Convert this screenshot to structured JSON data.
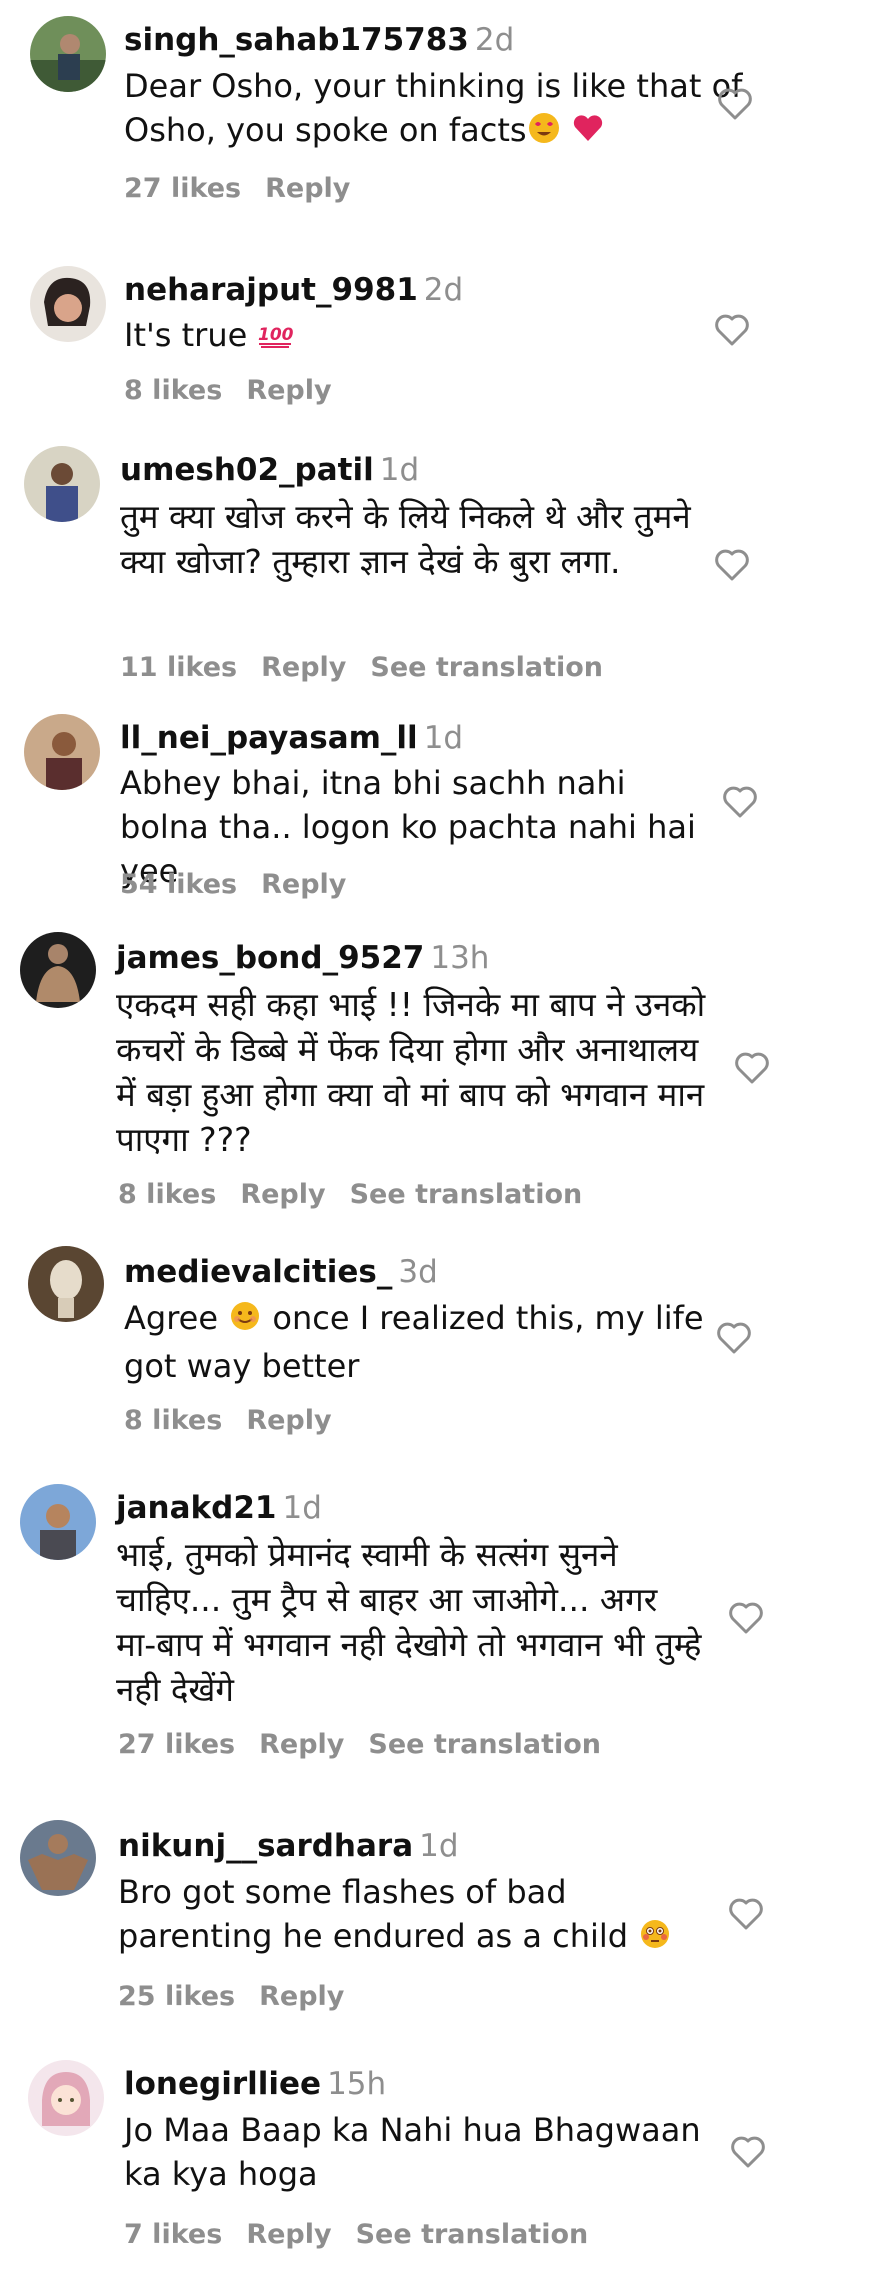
{
  "comments": [
    {
      "username": "singh_sahab175783",
      "time": "2d",
      "text": "Dear Osho, your thinking is like that of Osho, you spoke on facts",
      "likes": "27 likes",
      "reply": "Reply",
      "translation": ""
    },
    {
      "username": "neharajput_9981",
      "time": "2d",
      "text": "It's true",
      "likes": "8 likes",
      "reply": "Reply",
      "translation": ""
    },
    {
      "username": "umesh02_patil",
      "time": "1d",
      "text": "तुम क्या खोज करने के लिये निकले थे और तुमने क्या खोजा? तुम्हारा ज्ञान देखं के बुरा लगा.",
      "likes": "11 likes",
      "reply": "Reply",
      "translation": "See translation"
    },
    {
      "username": "ll_nei_payasam_ll",
      "time": "1d",
      "text": "Abhey bhai, itna bhi sachh nahi bolna tha.. logon ko pachta nahi hai yee",
      "likes": "54 likes",
      "reply": "Reply",
      "translation": ""
    },
    {
      "username": "james_bond_9527",
      "time": "13h",
      "text": "एकदम सही कहा भाई !! जिनके मा बाप ने उनको कचरों के डिब्बे में फेंक दिया होगा और अनाथालय में बड़ा हुआ होगा क्या वो मां बाप को भगवान मान पाएगा ???",
      "likes": "8 likes",
      "reply": "Reply",
      "translation": "See translation"
    },
    {
      "username": "medievalcities_",
      "time": "3d",
      "text": "once I realized this, my life got way better",
      "text_prefix": "Agree",
      "likes": "8 likes",
      "reply": "Reply",
      "translation": ""
    },
    {
      "username": "janakd21",
      "time": "1d",
      "text": "भाई, तुमको प्रेमानंद स्वामी के सत्संग सुनने चाहिए... तुम ट्रैप से बाहर आ जाओगे... अगर मा-बाप में भगवान नही देखोगे तो भगवान भी तुम्हे नही देखेंगे",
      "likes": "27 likes",
      "reply": "Reply",
      "translation": "See translation"
    },
    {
      "username": "nikunj__sardhara",
      "time": "1d",
      "text": "Bro got some flashes of bad parenting he endured as a child",
      "likes": "25 likes",
      "reply": "Reply",
      "translation": ""
    },
    {
      "username": "lonegirlliee",
      "time": "15h",
      "text": "Jo Maa Baap ka Nahi hua Bhagwaan ka kya hoga",
      "likes": "7 likes",
      "reply": "Reply",
      "translation": "See translation"
    }
  ],
  "icons": {
    "heart": "heart-outline-icon",
    "emoji_heart_eyes": "heart-eyes-emoji",
    "emoji_heart": "red-heart-emoji",
    "emoji_100": "hundred-points-emoji",
    "emoji_smile": "smiling-emoji",
    "emoji_flushed": "flushed-face-emoji"
  },
  "colors": {
    "text": "#111111",
    "muted": "#8e8e8e",
    "emoji_red": "#e0245e",
    "emoji_yellow": "#f5b81c"
  }
}
